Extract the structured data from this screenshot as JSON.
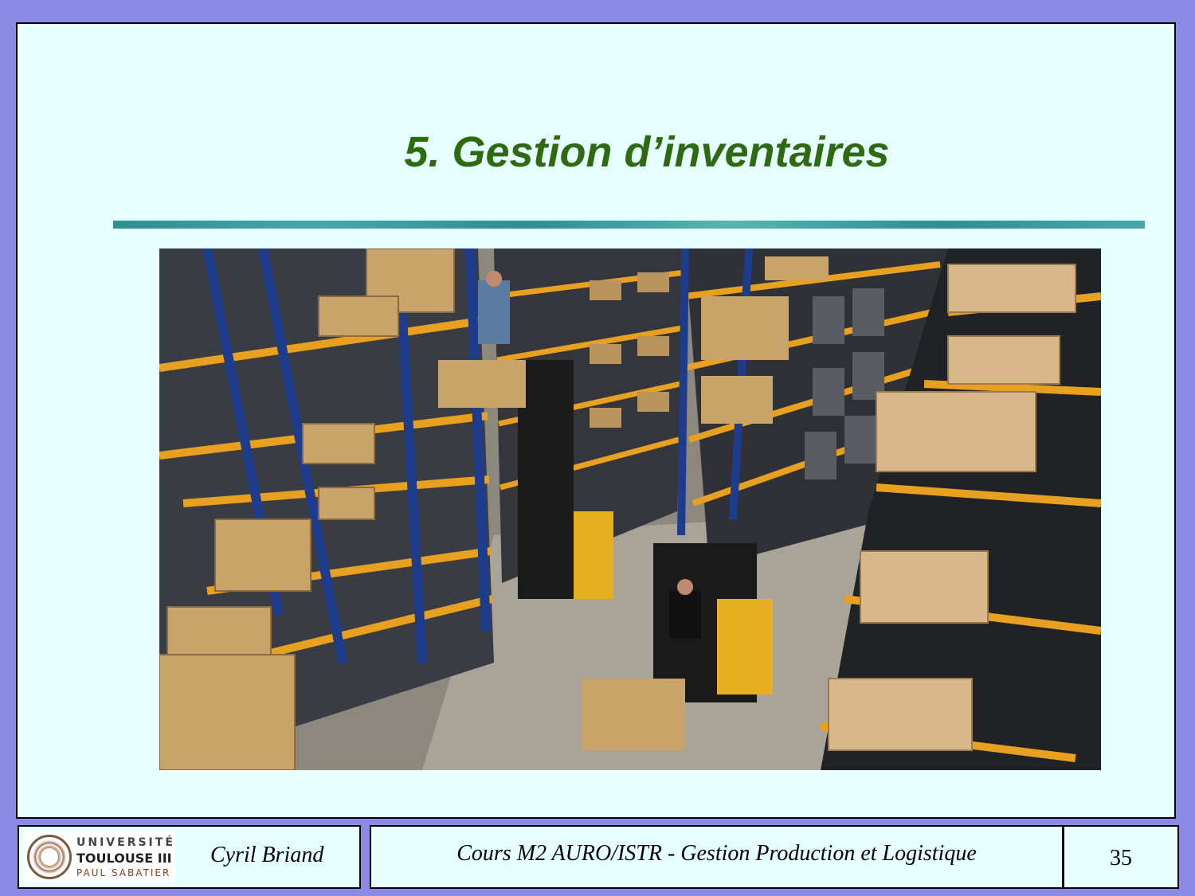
{
  "slide": {
    "title": "5. Gestion d’inventaires"
  },
  "image": {
    "description_icon": "warehouse-photo"
  },
  "footer": {
    "logo": {
      "line1": "UNIVERSITÉ",
      "line2": "TOULOUSE III",
      "line3": "PAUL SABATIER"
    },
    "author": "Cyril Briand",
    "course": "Cours M2 AURO/ISTR - Gestion Production et Logistique",
    "page_number": "35"
  },
  "colors": {
    "background": "#8b8be6",
    "slide": "#e6ffff",
    "title": "#2e6b10",
    "rule": "#2e8f8f"
  }
}
